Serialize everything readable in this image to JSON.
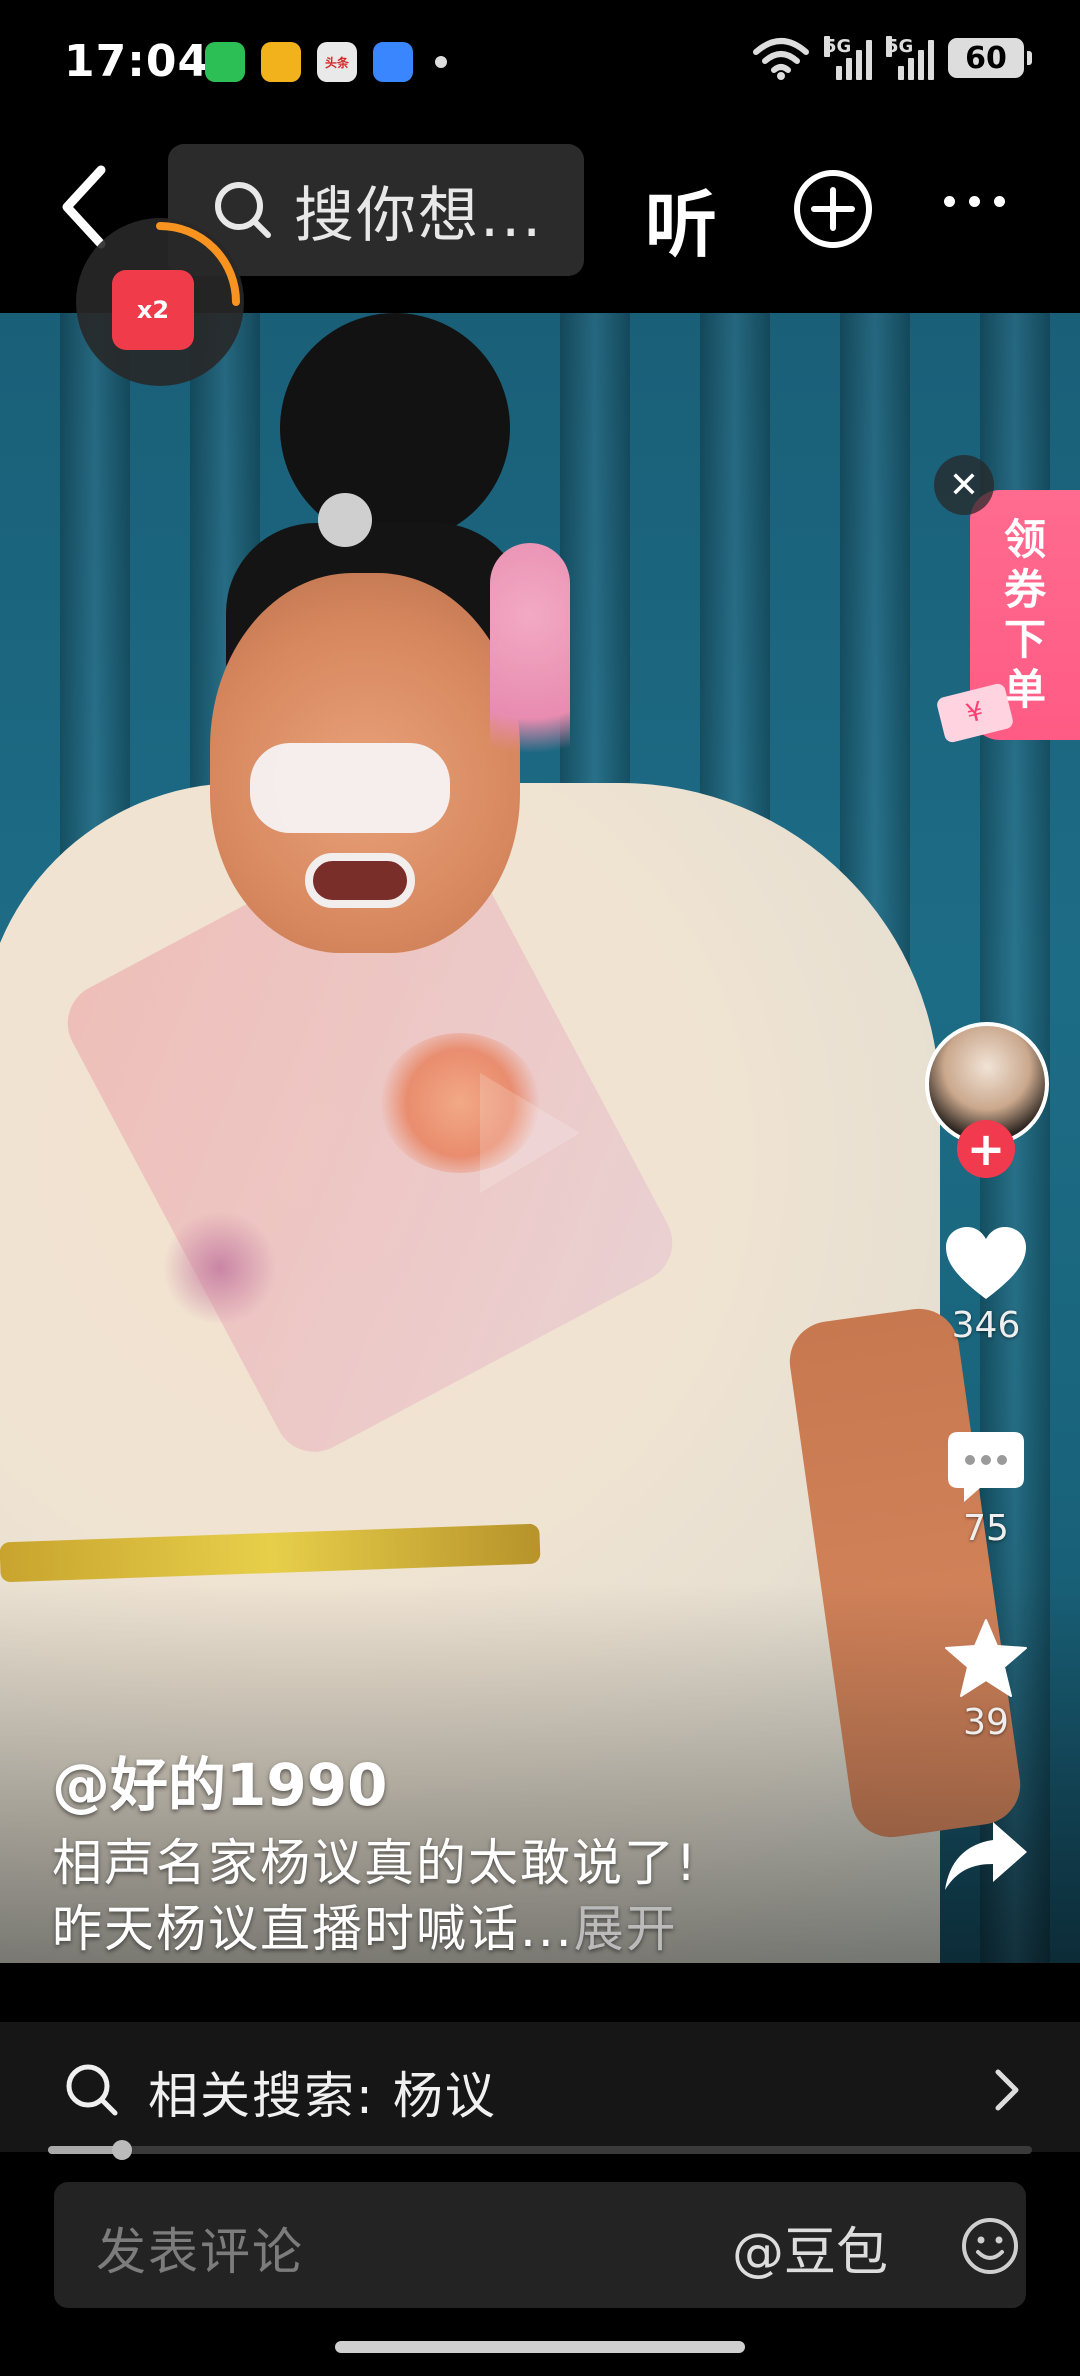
{
  "status_bar": {
    "time": "17:04",
    "network_1": "5G",
    "network_2": "5G",
    "battery": "60",
    "app_icons": [
      {
        "name": "wechat-icon",
        "color": "#2bbf55",
        "label": ""
      },
      {
        "name": "reader-icon",
        "color": "#f2b21c",
        "label": ""
      },
      {
        "name": "toutiao-icon",
        "color": "#e9e9e9",
        "label": "头条"
      },
      {
        "name": "browser-icon",
        "color": "#3a86ff",
        "label": ""
      }
    ]
  },
  "top_nav": {
    "search_placeholder": "搜你想...",
    "listen_label": "听"
  },
  "red_packet": {
    "multiplier": "x2"
  },
  "coupon": {
    "chars": [
      "领",
      "券",
      "下",
      "单"
    ],
    "tag": "¥"
  },
  "actions": {
    "likes": "346",
    "comments": "75",
    "favorites": "39"
  },
  "post": {
    "author": "@好的1990",
    "caption_line1": "相声名家杨议真的太敢说了!",
    "caption_line2": "昨天杨议直播时喊话...",
    "expand_label": "展开"
  },
  "related_search": {
    "label": "相关搜索: 杨议"
  },
  "progress": {
    "fraction": 0.075
  },
  "comment_box": {
    "placeholder": "发表评论",
    "mention": "@豆包"
  },
  "colors": {
    "accent_red": "#f23a4e",
    "coupon_pink": "#ff5b84"
  }
}
